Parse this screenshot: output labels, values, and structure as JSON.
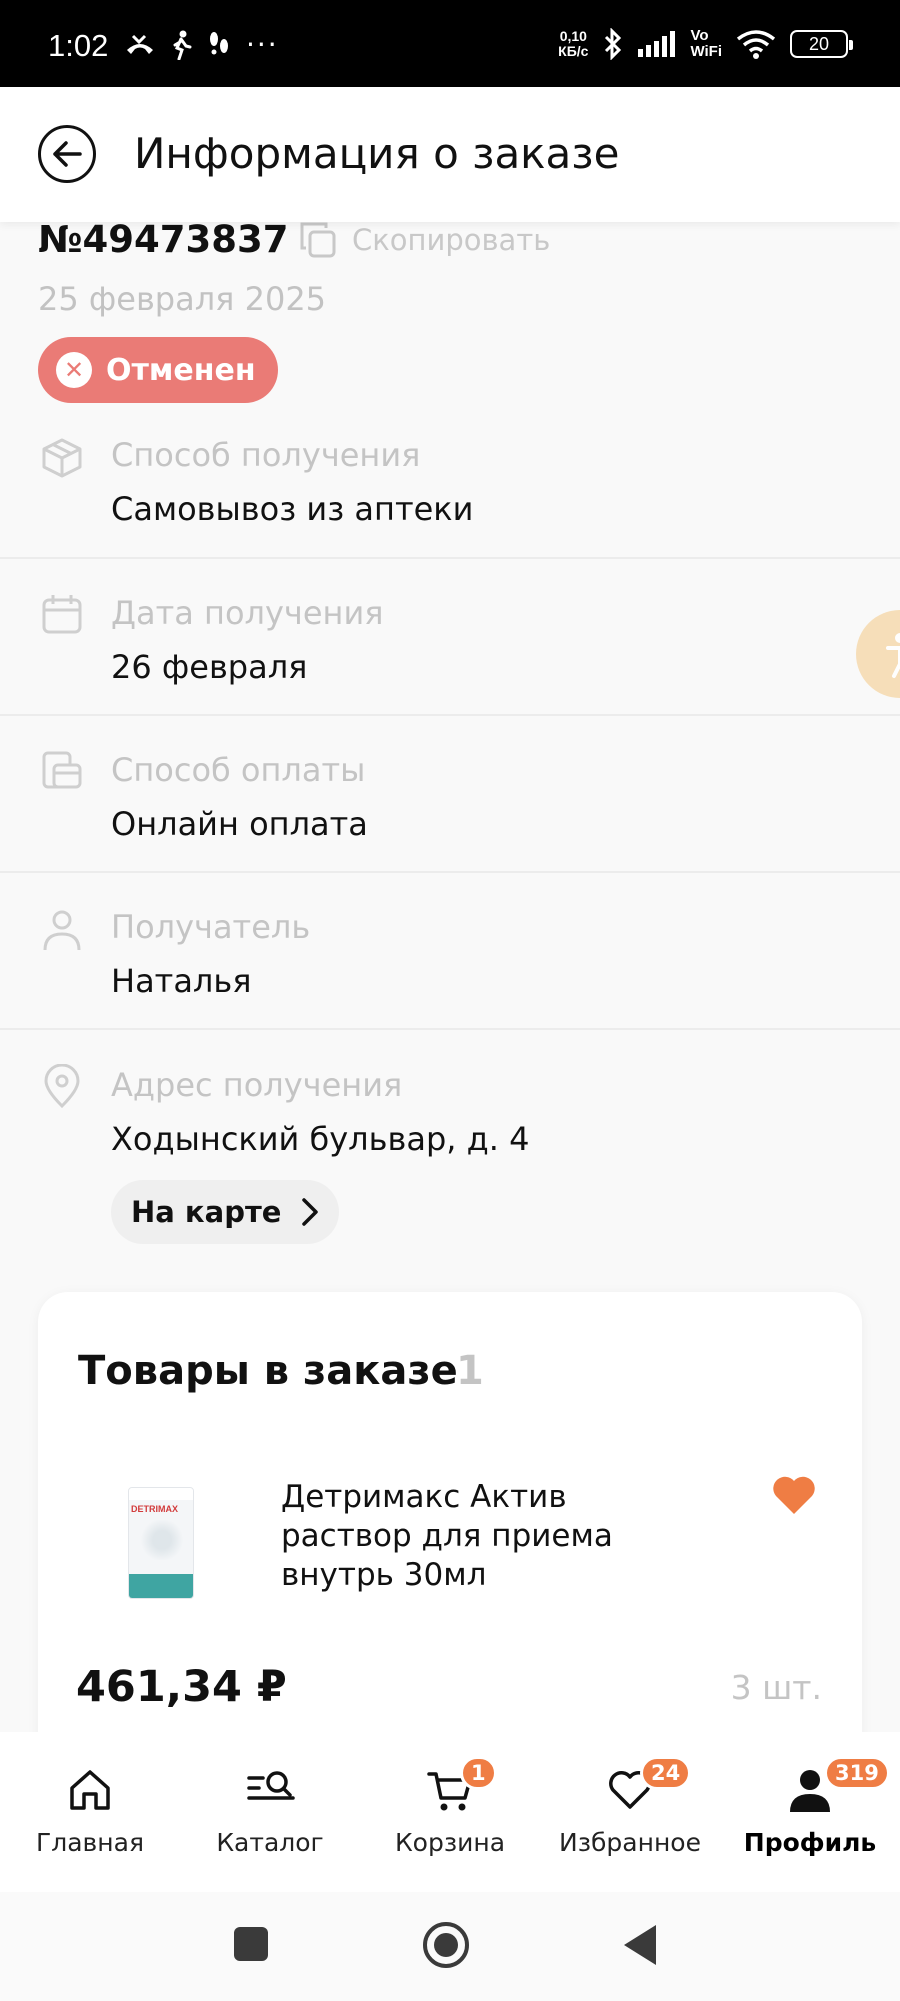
{
  "status_bar": {
    "time": "1:02",
    "left_icons": [
      "missed-call-icon",
      "walking-icon",
      "steps-icon"
    ],
    "more": "···",
    "net_speed": "0,10\nКБ/с",
    "bluetooth": "bluetooth-icon",
    "signal": "signal-icon",
    "vowifi": "Vo\nWiFi",
    "wifi": "wifi-icon",
    "battery": "20"
  },
  "header": {
    "title": "Информация о заказе"
  },
  "order": {
    "number": "№49473837",
    "copy_label": "Скопировать",
    "date": "25 февраля 2025",
    "status": "Отменен",
    "status_color": "#ea7b76"
  },
  "info": {
    "delivery_method_label": "Способ получения",
    "delivery_method_value": "Самовывоз из аптеки",
    "date_label": "Дата получения",
    "date_value": "26 февраля",
    "payment_label": "Способ оплаты",
    "payment_value": "Онлайн оплата",
    "recipient_label": "Получатель",
    "recipient_value": "Наталья",
    "address_label": "Адрес получения",
    "address_value": "Ходынский бульвар, д. 4",
    "map_button": "На карте"
  },
  "products": {
    "title": "Товары в заказе",
    "count": "1",
    "items": [
      {
        "name": "Детримакс Актив раствор для приема внутрь 30мл",
        "price": "461,34 ₽",
        "qty": "3 шт.",
        "favorite": true,
        "image_brand": "DETRIMAX"
      }
    ]
  },
  "bottom_nav": {
    "items": [
      {
        "label": "Главная",
        "icon": "home-icon"
      },
      {
        "label": "Каталог",
        "icon": "catalog-search-icon"
      },
      {
        "label": "Корзина",
        "icon": "cart-icon",
        "badge": "1"
      },
      {
        "label": "Избранное",
        "icon": "heart-icon",
        "badge": "24"
      },
      {
        "label": "Профиль",
        "icon": "profile-icon",
        "badge": "319",
        "active": true
      }
    ],
    "badge_color": "#ef7d44"
  }
}
